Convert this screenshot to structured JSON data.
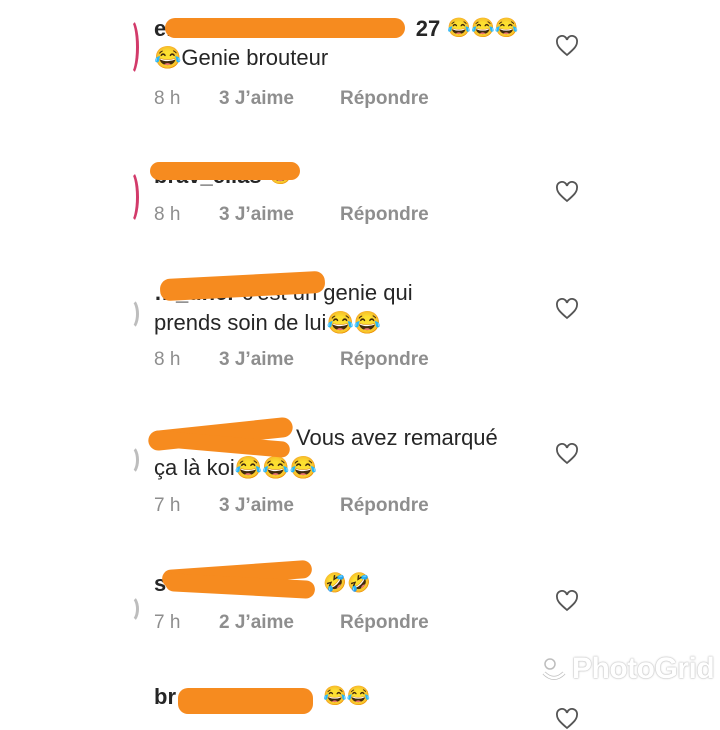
{
  "comments": [
    {
      "username": "em",
      "username_tail": "27",
      "text_line1": "😂😂😂",
      "text_line2": "😂Genie brouteur",
      "time": "8 h",
      "likes": "3 J’aime",
      "reply": "Répondre"
    },
    {
      "username": "brav_elias",
      "text_line1": "😂",
      "time": "8 h",
      "likes": "3 J’aime",
      "reply": "Répondre"
    },
    {
      "username": "…_uher",
      "text_line1": "c'est un genie qui",
      "text_line2": "prends soin de lui😂😂",
      "time": "8 h",
      "likes": "3 J’aime",
      "reply": "Répondre"
    },
    {
      "text_line1": "Vous avez remarqué",
      "text_line2": "ça là koi😂😂😂",
      "time": "7 h",
      "likes": "3 J’aime",
      "reply": "Répondre"
    },
    {
      "username": "s",
      "text_line1": "🤣🤣",
      "time": "7 h",
      "likes": "2 J’aime",
      "reply": "Répondre"
    },
    {
      "username": "br",
      "text_line1": "😂😂",
      "time": "",
      "likes": "",
      "reply": ""
    }
  ],
  "watermark": "PhotoGrid",
  "colors": {
    "redaction": "#f68b1f",
    "avatar_ring": "#d23a6a",
    "meta": "#8e8e8e"
  },
  "icons": {
    "like": "heart-outline-icon"
  }
}
